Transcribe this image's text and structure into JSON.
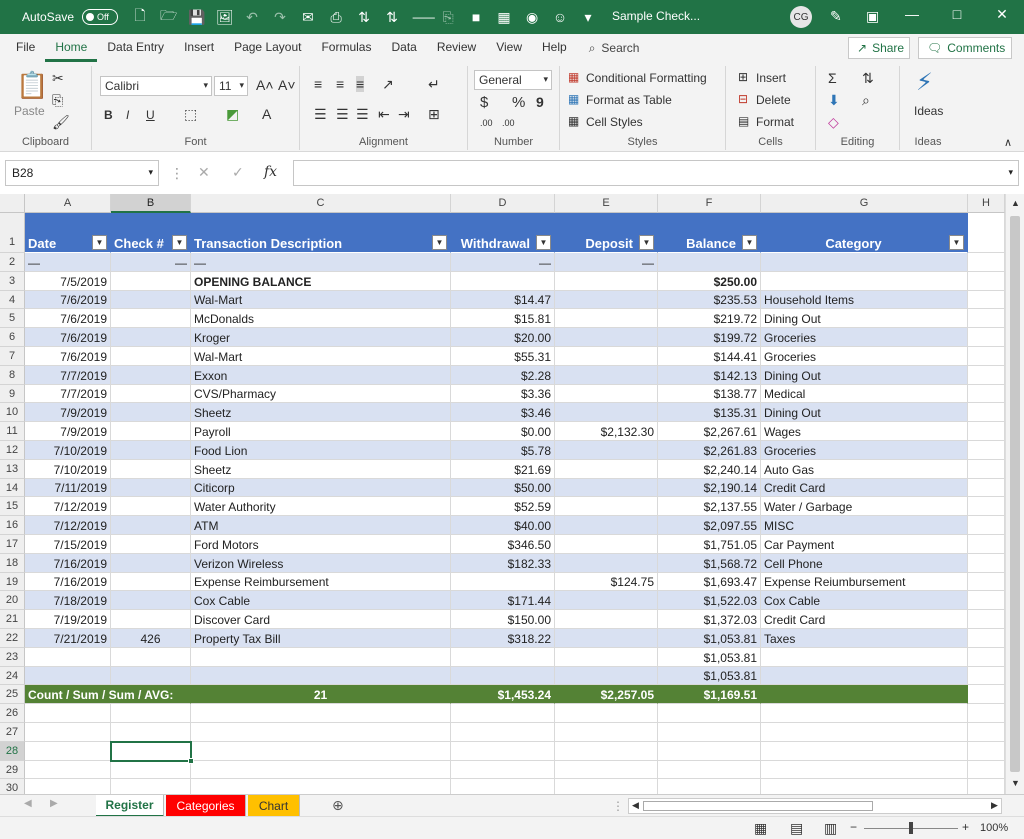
{
  "titlebar": {
    "autosave_label": "AutoSave",
    "autosave_state": "Off",
    "doc_title": "Sample Check...",
    "user_initials": "CG"
  },
  "ribbon_tabs": [
    "File",
    "Home",
    "Data Entry",
    "Insert",
    "Page Layout",
    "Formulas",
    "Data",
    "Review",
    "View",
    "Help"
  ],
  "search_label": "Search",
  "share_label": "Share",
  "comments_label": "Comments",
  "ribbon": {
    "clipboard": {
      "paste": "Paste",
      "name": "Clipboard"
    },
    "font": {
      "family": "Calibri",
      "size": "11",
      "name": "Font",
      "bold": "B",
      "italic": "I",
      "underline": "U"
    },
    "alignment": {
      "name": "Alignment"
    },
    "number": {
      "format": "General",
      "name": "Number",
      "currency": "$",
      "percent": "%",
      "comma": "9",
      "inc_decimal": ".00",
      "dec_decimal": ".00"
    },
    "styles": {
      "conditional": "Conditional Formatting",
      "table": "Format as Table",
      "cell": "Cell Styles",
      "name": "Styles"
    },
    "cells": {
      "insert": "Insert",
      "delete": "Delete",
      "format": "Format",
      "name": "Cells"
    },
    "editing": {
      "name": "Editing"
    },
    "ideas": {
      "label": "Ideas",
      "name": "Ideas"
    }
  },
  "formula_bar": {
    "name_box": "B28",
    "fx": "fx",
    "value": ""
  },
  "columns": [
    "A",
    "B",
    "C",
    "D",
    "E",
    "F",
    "G",
    "H"
  ],
  "header_row": {
    "A": "Date",
    "B": "Check #",
    "C": "Transaction Description",
    "D": "Withdrawal",
    "E": "Deposit",
    "F": "Balance",
    "G": "Category"
  },
  "row2": {
    "A": "—",
    "B": "—",
    "C": "—",
    "D": "—",
    "E": "—"
  },
  "rows": [
    {
      "A": "7/5/2019",
      "B": "",
      "C": "OPENING BALANCE",
      "D": "",
      "E": "",
      "F": "$250.00",
      "G": ""
    },
    {
      "A": "7/6/2019",
      "B": "",
      "C": "Wal-Mart",
      "D": "$14.47",
      "E": "",
      "F": "$235.53",
      "G": "Household Items"
    },
    {
      "A": "7/6/2019",
      "B": "",
      "C": "McDonalds",
      "D": "$15.81",
      "E": "",
      "F": "$219.72",
      "G": "Dining Out"
    },
    {
      "A": "7/6/2019",
      "B": "",
      "C": "Kroger",
      "D": "$20.00",
      "E": "",
      "F": "$199.72",
      "G": "Groceries"
    },
    {
      "A": "7/6/2019",
      "B": "",
      "C": "Wal-Mart",
      "D": "$55.31",
      "E": "",
      "F": "$144.41",
      "G": "Groceries"
    },
    {
      "A": "7/7/2019",
      "B": "",
      "C": "Exxon",
      "D": "$2.28",
      "E": "",
      "F": "$142.13",
      "G": "Dining Out"
    },
    {
      "A": "7/7/2019",
      "B": "",
      "C": "CVS/Pharmacy",
      "D": "$3.36",
      "E": "",
      "F": "$138.77",
      "G": "Medical"
    },
    {
      "A": "7/9/2019",
      "B": "",
      "C": "Sheetz",
      "D": "$3.46",
      "E": "",
      "F": "$135.31",
      "G": "Dining Out"
    },
    {
      "A": "7/9/2019",
      "B": "",
      "C": "Payroll",
      "D": "$0.00",
      "E": "$2,132.30",
      "F": "$2,267.61",
      "G": "Wages"
    },
    {
      "A": "7/10/2019",
      "B": "",
      "C": "Food Lion",
      "D": "$5.78",
      "E": "",
      "F": "$2,261.83",
      "G": "Groceries"
    },
    {
      "A": "7/10/2019",
      "B": "",
      "C": "Sheetz",
      "D": "$21.69",
      "E": "",
      "F": "$2,240.14",
      "G": "Auto Gas"
    },
    {
      "A": "7/11/2019",
      "B": "",
      "C": "Citicorp",
      "D": "$50.00",
      "E": "",
      "F": "$2,190.14",
      "G": "Credit Card"
    },
    {
      "A": "7/12/2019",
      "B": "",
      "C": "Water Authority",
      "D": "$52.59",
      "E": "",
      "F": "$2,137.55",
      "G": "Water / Garbage"
    },
    {
      "A": "7/12/2019",
      "B": "",
      "C": "ATM",
      "D": "$40.00",
      "E": "",
      "F": "$2,097.55",
      "G": "MISC"
    },
    {
      "A": "7/15/2019",
      "B": "",
      "C": "Ford Motors",
      "D": "$346.50",
      "E": "",
      "F": "$1,751.05",
      "G": "Car Payment"
    },
    {
      "A": "7/16/2019",
      "B": "",
      "C": "Verizon Wireless",
      "D": "$182.33",
      "E": "",
      "F": "$1,568.72",
      "G": "Cell Phone"
    },
    {
      "A": "7/16/2019",
      "B": "",
      "C": "Expense Reimbursement",
      "D": "",
      "E": "$124.75",
      "F": "$1,693.47",
      "G": "Expense Reiumbursement"
    },
    {
      "A": "7/18/2019",
      "B": "",
      "C": "Cox Cable",
      "D": "$171.44",
      "E": "",
      "F": "$1,522.03",
      "G": "Cox Cable"
    },
    {
      "A": "7/19/2019",
      "B": "",
      "C": "Discover Card",
      "D": "$150.00",
      "E": "",
      "F": "$1,372.03",
      "G": "Credit Card"
    },
    {
      "A": "7/21/2019",
      "B": "426",
      "C": "Property Tax Bill",
      "D": "$318.22",
      "E": "",
      "F": "$1,053.81",
      "G": "Taxes"
    },
    {
      "A": "",
      "B": "",
      "C": "",
      "D": "",
      "E": "",
      "F": "$1,053.81",
      "G": ""
    },
    {
      "A": "",
      "B": "",
      "C": "",
      "D": "",
      "E": "",
      "F": "$1,053.81",
      "G": ""
    }
  ],
  "totals_row": {
    "label": "Count / Sum / Sum / AVG:",
    "C": "21",
    "D": "$1,453.24",
    "E": "$2,257.05",
    "F": "$1,169.51"
  },
  "row_numbers": [
    "1",
    "2",
    "3",
    "4",
    "5",
    "6",
    "7",
    "8",
    "9",
    "10",
    "11",
    "12",
    "13",
    "14",
    "15",
    "16",
    "17",
    "18",
    "19",
    "20",
    "21",
    "22",
    "23",
    "24",
    "25",
    "26",
    "27",
    "28",
    "29",
    "30"
  ],
  "sheet_tabs": [
    {
      "label": "Register",
      "color": "#ffffff",
      "text_color": "#217346"
    },
    {
      "label": "Categories",
      "color": "#ff0000",
      "text_color": "#ffffff"
    },
    {
      "label": "Chart",
      "color": "#ffc000",
      "text_color": "#333333"
    }
  ],
  "status": {
    "zoom": "100%"
  },
  "colors": {
    "accent": "#217346",
    "header": "#4472c4",
    "band": "#d9e1f2",
    "totals": "#548235"
  }
}
